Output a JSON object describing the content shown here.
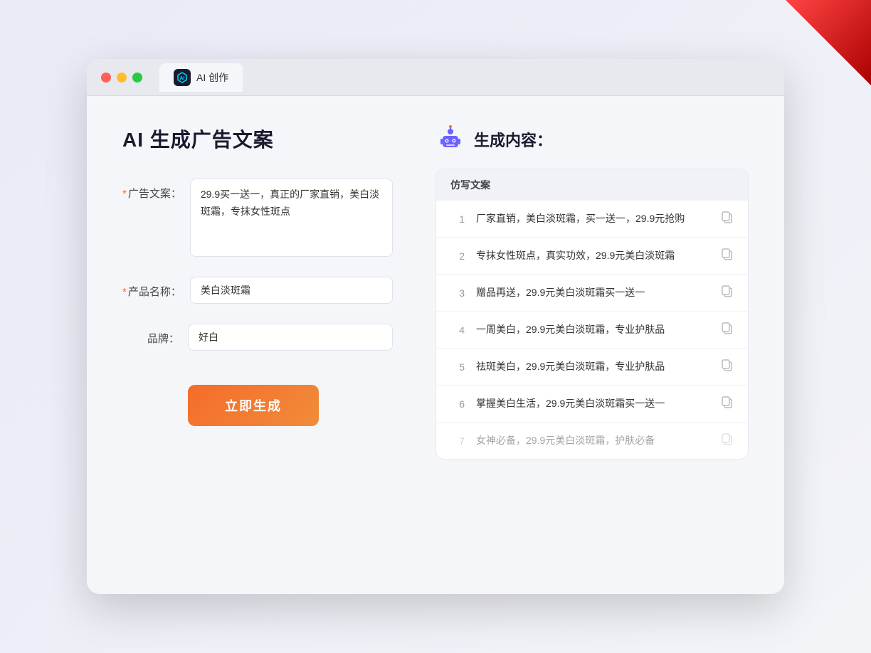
{
  "browser": {
    "tab_label": "AI 创作",
    "tab_icon": "AI"
  },
  "page": {
    "title": "AI 生成广告文案",
    "right_title": "生成内容："
  },
  "form": {
    "ad_copy_label": "广告文案：",
    "ad_copy_required": "*",
    "ad_copy_value": "29.9买一送一，真正的厂家直销，美白淡斑霜，专抹女性斑点",
    "product_name_label": "产品名称：",
    "product_name_required": "*",
    "product_name_value": "美白淡斑霜",
    "brand_label": "品牌：",
    "brand_value": "好白",
    "generate_btn": "立即生成"
  },
  "results": {
    "header": "仿写文案",
    "items": [
      {
        "num": "1",
        "text": "厂家直销，美白淡斑霜，买一送一，29.9元抢购",
        "faded": false
      },
      {
        "num": "2",
        "text": "专抹女性斑点，真实功效，29.9元美白淡斑霜",
        "faded": false
      },
      {
        "num": "3",
        "text": "赠品再送，29.9元美白淡斑霜买一送一",
        "faded": false
      },
      {
        "num": "4",
        "text": "一周美白，29.9元美白淡斑霜，专业护肤品",
        "faded": false
      },
      {
        "num": "5",
        "text": "祛斑美白，29.9元美白淡斑霜，专业护肤品",
        "faded": false
      },
      {
        "num": "6",
        "text": "掌握美白生活，29.9元美白淡斑霜买一送一",
        "faded": false
      },
      {
        "num": "7",
        "text": "女神必备，29.9元美白淡斑霜，护肤必备",
        "faded": true
      }
    ]
  }
}
